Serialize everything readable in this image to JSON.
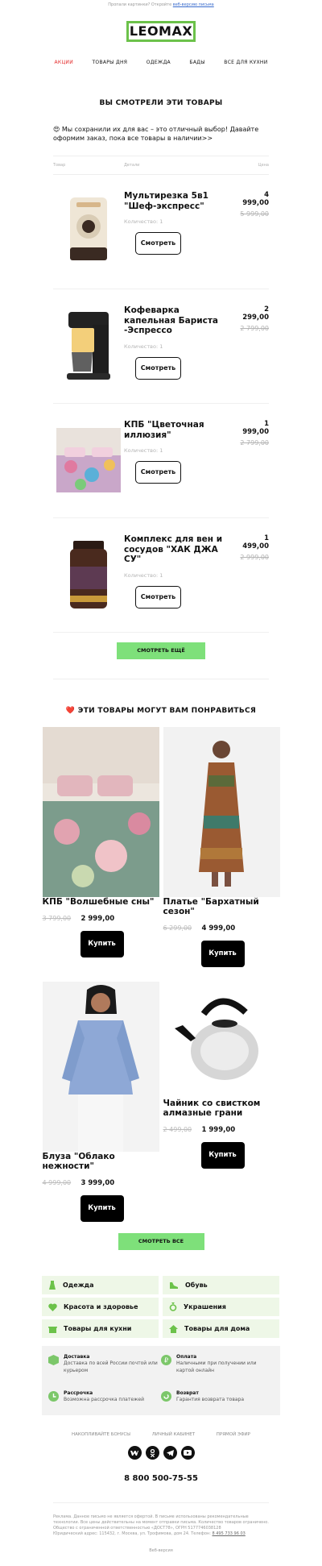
{
  "topnote": {
    "text": "Пропали картинки? Откройте",
    "link": "веб-версию письма"
  },
  "logo": "LEOMAX",
  "nav": [
    "АКЦИИ",
    "ТОВАРЫ ДНЯ",
    "ОДЕЖДА",
    "БАДЫ",
    "ВСЕ ДЛЯ КУХНИ"
  ],
  "viewed": {
    "title": "ВЫ СМОТРЕЛИ ЭТИ ТОВАРЫ",
    "intro": "😍 Мы сохранили их для вас – это отличный выбор! Давайте оформим заказ, пока все товары в наличии>>",
    "col_product": "Товар",
    "col_details": "Детали",
    "col_price": "Цена",
    "button": "Смотреть",
    "items": [
      {
        "name": "Мультирезка 5в1 \"Шеф-экспресс\"",
        "qty": "Количество: 1",
        "price": "4 999,00",
        "old": "5 999,00"
      },
      {
        "name": "Кофеварка капельная Бариста -Эспрессо",
        "qty": "Количество: 1",
        "price": "2 299,00",
        "old": "2 799,00"
      },
      {
        "name": "КПБ \"Цветочная иллюзия\"",
        "qty": "Количество: 1",
        "price": "1 999,00",
        "old": "2 799,00"
      },
      {
        "name": "Комплекс для вен и сосудов \"ХАК ДЖА СУ\"",
        "qty": "Количество: 1",
        "price": "1 499,00",
        "old": "2 999,00"
      }
    ],
    "more": "СМОТРЕТЬ ЕЩЁ"
  },
  "recommend": {
    "title": "❤️ ЭТИ ТОВАРЫ МОГУТ ВАМ ПОНРАВИТЬСЯ",
    "buy": "Купить",
    "cards": [
      {
        "name": "КПБ \"Волшебные сны\"",
        "old": "3 799,00",
        "price": "2 999,00"
      },
      {
        "name": "Платье \"Бархатный сезон\"",
        "old": "6 299,00",
        "price": "4 999,00"
      },
      {
        "name": "Блуза \"Облако нежности\"",
        "old": "4 999,00",
        "price": "3 999,00"
      },
      {
        "name": "Чайник со свистком алмазные грани",
        "old": "2 499,00",
        "price": "1 999,00"
      }
    ],
    "all": "СМОТРЕТЬ ВСЕ"
  },
  "categories": [
    "Одежда",
    "Обувь",
    "Красота и здоровье",
    "Украшения",
    "Товары для кухни",
    "Товары для дома"
  ],
  "info": [
    {
      "title": "Доставка",
      "desc": "Доставка по всей России почтой или курьером"
    },
    {
      "title": "Оплата",
      "desc": "Наличными при получении или картой онлайн"
    },
    {
      "title": "Рассрочка",
      "desc": "Возможна рассрочка платежей"
    },
    {
      "title": "Возврат",
      "desc": "Гарантия возврата товара"
    }
  ],
  "footer_links": [
    "НАКОПЛИВАЙТЕ БОНУСЫ",
    "ЛИЧНЫЙ КАБИНЕТ",
    "ПРЯМОЙ ЭФИР"
  ],
  "phone": "8 800 500-75-55",
  "legal": {
    "line1": "Реклама. Данное письмо не является офертой. В письме использованы рекомендательные технологии. Все цены действительны на момент отправки письма. Количество товаров ограничено. Общество с ограниченной ответственностью «ДОСТ78», ОГРН 5177746038128",
    "line2": "Юридический адрес: 115432, г. Москва, ул. Трофимова, дом 24. Телефон:",
    "tel": "8 495 733 96 03"
  },
  "web": "Веб-версия",
  "colors": {
    "accent_green": "#6cc24a",
    "button_green": "#7ee07a",
    "nav_active": "#e42b2b"
  }
}
